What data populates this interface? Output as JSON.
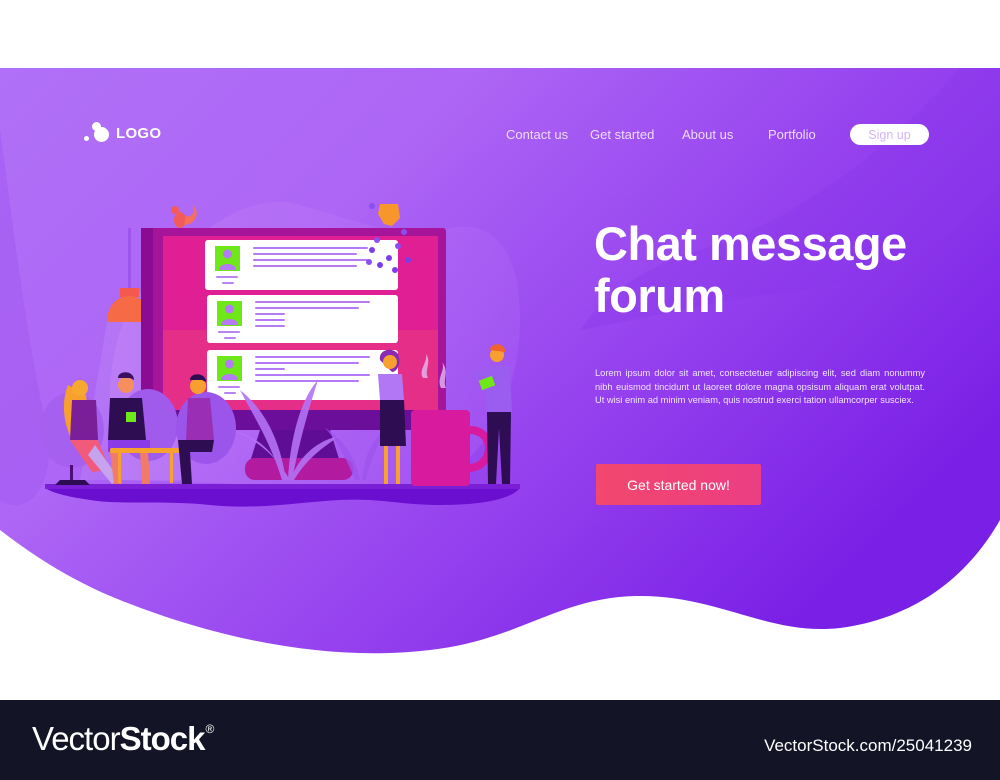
{
  "header": {
    "logo_text": "LOGO",
    "nav": [
      {
        "label": "Contact us"
      },
      {
        "label": "Get started"
      },
      {
        "label": "About us"
      },
      {
        "label": "Portfolio"
      }
    ],
    "signup_label": "Sign up"
  },
  "hero": {
    "title_line1": "Chat message",
    "title_line2": "forum",
    "description": "Lorem ipsum dolor sit amet, consectetuer adipiscing elit, sed diam nonummy nibh euismod tincidunt ut laoreet dolore magna opsisum aliquam erat volutpat. Ut wisi enim ad minim veniam, quis nostrud exerci tation ullamcorper susciex.",
    "cta_label": "Get started now!"
  },
  "illustration": {
    "subject": "people chatting around a large monitor showing forum message cards",
    "message_cards": 3
  },
  "footer": {
    "brand_light": "Vector",
    "brand_bold": "Stock",
    "brand_mark": "®",
    "image_id_text": "VectorStock.com/25041239"
  },
  "colors": {
    "bg_purple_light": "#b36cf6",
    "bg_purple_dark": "#7a1fe6",
    "cta": "#f0436f",
    "monitor_screen": "#e0299a",
    "avatar_green": "#6fe81a",
    "footer_bg": "#131426"
  }
}
